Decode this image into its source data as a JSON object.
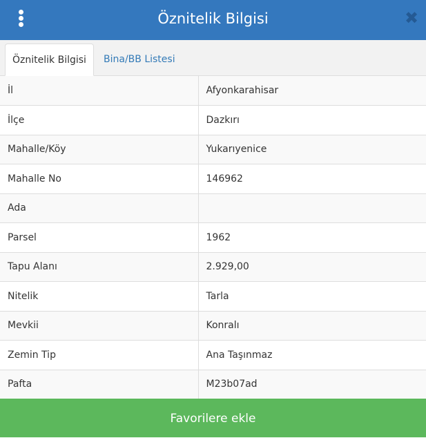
{
  "header": {
    "title": "Öznitelik Bilgisi",
    "close_symbol": "✖",
    "color": "#3478be"
  },
  "tabs": [
    {
      "label": "Öznitelik Bilgisi",
      "active": true
    },
    {
      "label": "Bina/BB Listesi",
      "active": false
    }
  ],
  "attributes": [
    {
      "key": "İl",
      "value": "Afyonkarahisar"
    },
    {
      "key": "İlçe",
      "value": "Dazkırı"
    },
    {
      "key": "Mahalle/Köy",
      "value": "Yukarıyenice"
    },
    {
      "key": "Mahalle No",
      "value": "146962"
    },
    {
      "key": "Ada",
      "value": ""
    },
    {
      "key": "Parsel",
      "value": "1962"
    },
    {
      "key": "Tapu Alanı",
      "value": "2.929,00"
    },
    {
      "key": "Nitelik",
      "value": "Tarla"
    },
    {
      "key": "Mevkii",
      "value": "Konralı"
    },
    {
      "key": "Zemin Tip",
      "value": "Ana Taşınmaz"
    },
    {
      "key": "Pafta",
      "value": "M23b07ad"
    }
  ],
  "footer": {
    "button_label": "Favorilere ekle",
    "color": "#5cb85c"
  },
  "icons": {
    "menu": "vertical-dots-icon",
    "close": "close-icon"
  }
}
